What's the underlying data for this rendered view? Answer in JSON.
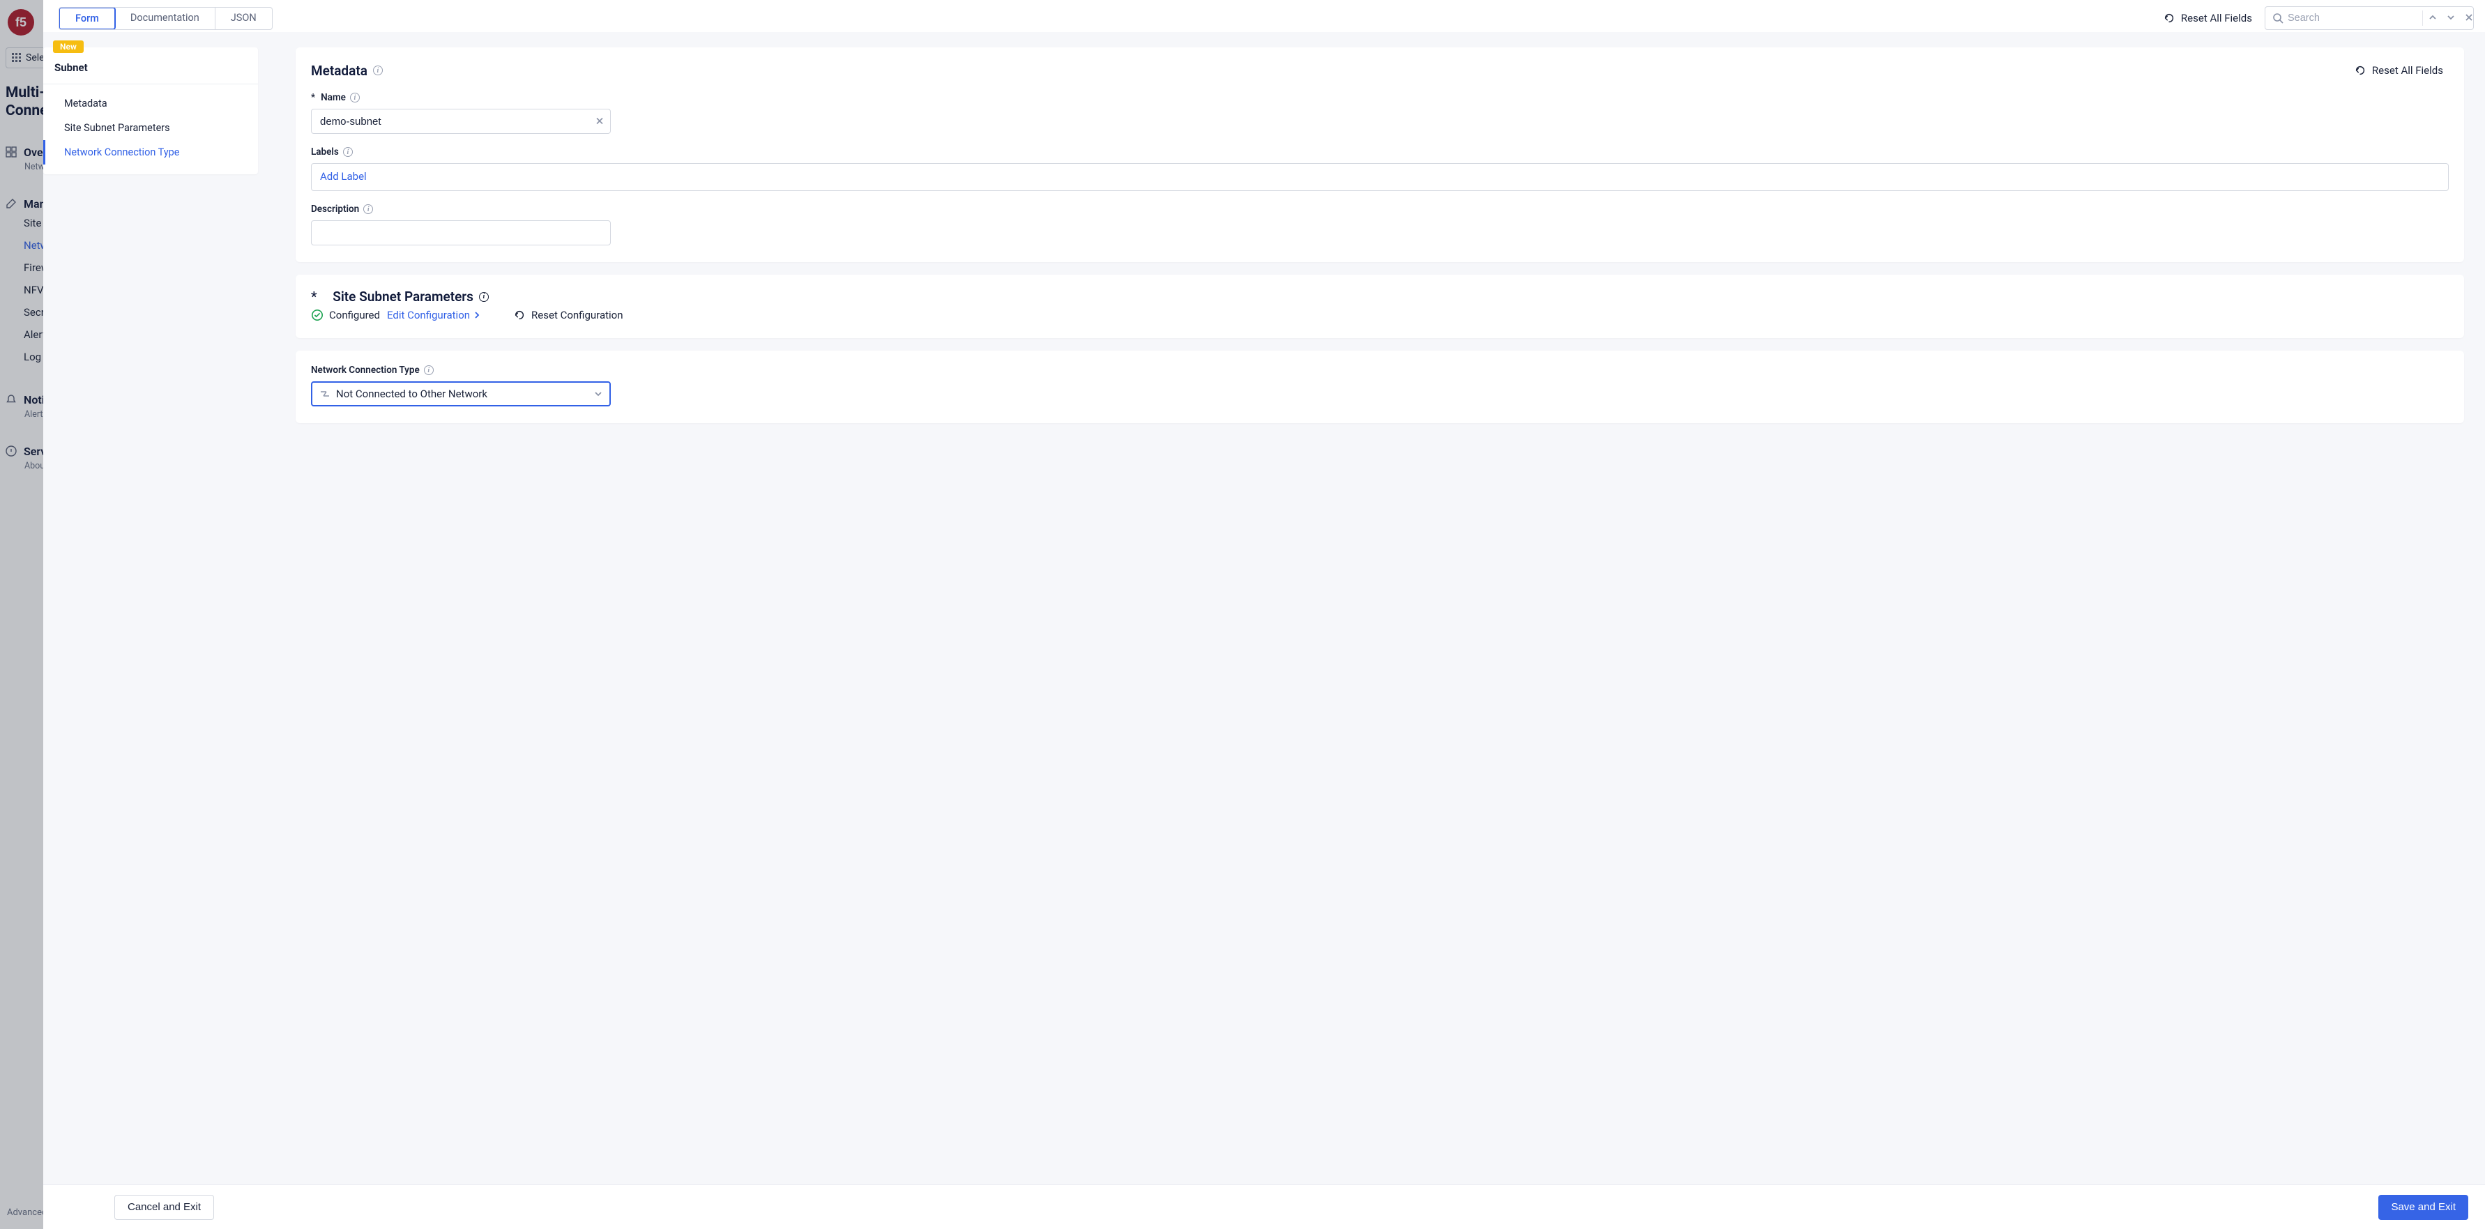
{
  "background": {
    "service_select": "Sele",
    "app_title": "Multi-C\nConnec",
    "overview": "Ove",
    "overview_sub": "Netw",
    "manage_label": "Man",
    "items": [
      "Site",
      "Netw",
      "Firew",
      "NFV",
      "Secr",
      "Alert",
      "Log"
    ],
    "active_idx": 1,
    "notifications": "Noti",
    "notifications_sub": "Alerts",
    "services": "Serv",
    "services_sub": "About",
    "footer": "Advanced"
  },
  "tabs": {
    "form": "Form",
    "documentation": "Documentation",
    "json": "JSON"
  },
  "reset_all": "Reset All Fields",
  "search": {
    "placeholder": "Search"
  },
  "nav": {
    "badge": "New",
    "title": "Subnet",
    "items": [
      {
        "label": "Metadata"
      },
      {
        "label": "Site Subnet Parameters"
      },
      {
        "label": "Network Connection Type"
      }
    ],
    "active_idx": 2
  },
  "metadata": {
    "title": "Metadata",
    "reset": "Reset All Fields",
    "name": {
      "label": "Name",
      "value": "demo-subnet"
    },
    "labels": {
      "label": "Labels",
      "placeholder": "Add Label"
    },
    "description": {
      "label": "Description",
      "value": ""
    }
  },
  "site_subnet": {
    "title": "Site Subnet Parameters",
    "status": "Configured",
    "edit": "Edit Configuration",
    "reset": "Reset Configuration"
  },
  "network_conn": {
    "label": "Network Connection Type",
    "value": "Not Connected to Other Network"
  },
  "footer": {
    "cancel": "Cancel and Exit",
    "save": "Save and Exit"
  }
}
